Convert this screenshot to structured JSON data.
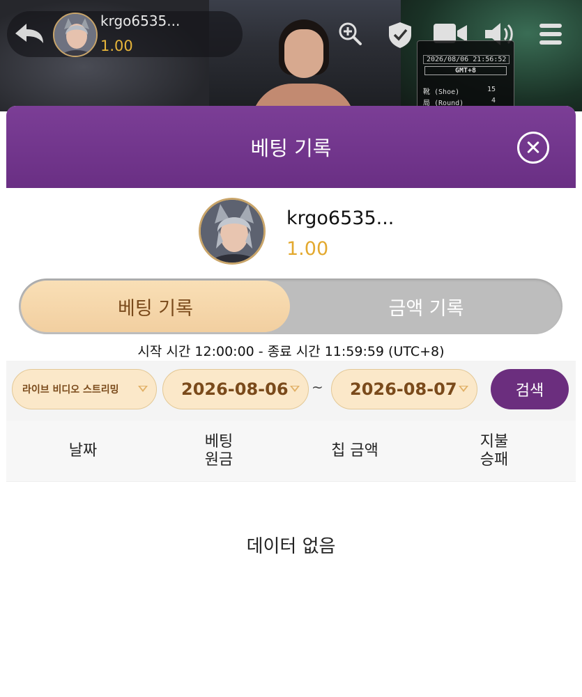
{
  "game_view": {
    "player_name": "krgo6535...",
    "player_balance": "1.00",
    "score_card": {
      "datetime": "2026/08/06 21:56:52",
      "timezone": "GMT+8",
      "shoe_label": "靴 (Shoe)",
      "shoe_value": "15",
      "round_label": "局 (Round)",
      "round_value": "4"
    },
    "icons": [
      "back-icon",
      "zoom-in-icon",
      "shield-check-icon",
      "video-camera-icon",
      "speaker-icon",
      "menu-icon"
    ]
  },
  "modal": {
    "title": "베팅 기록",
    "user": {
      "name": "krgo6535...",
      "balance": "1.00"
    },
    "tabs": [
      {
        "label": "베팅 기록",
        "active": true
      },
      {
        "label": "금액 기록",
        "active": false
      }
    ],
    "time_range": "시작 시간 12:00:00 - 종료 시간 11:59:59 (UTC+8)",
    "filters": {
      "game_type": "라이브 비디오 스트리밍",
      "start_date": "2026-08-06",
      "separator": "~",
      "end_date": "2026-08-07",
      "search_label": "검색"
    },
    "table": {
      "columns": [
        {
          "line1": "날짜",
          "line2": ""
        },
        {
          "line1": "베팅",
          "line2": "원금"
        },
        {
          "line1": "칩 금액",
          "line2": ""
        },
        {
          "line1": "지불",
          "line2": "승패"
        }
      ]
    },
    "empty_message": "데이터 없음"
  },
  "colors": {
    "header_purple": "#7b3e96",
    "accent_gold": "#e3a92f",
    "tab_active_bg": "#f2cfa0",
    "search_button": "#6b2e7e"
  }
}
